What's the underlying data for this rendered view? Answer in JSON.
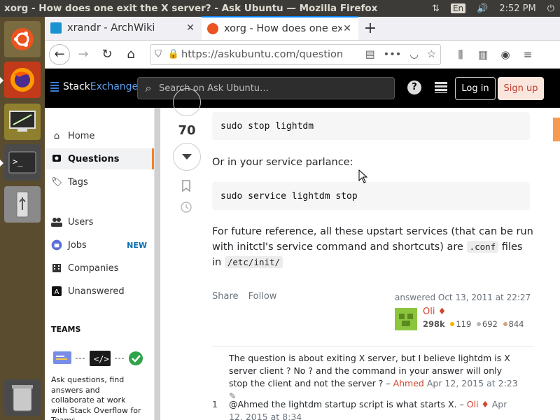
{
  "os_bar": {
    "window_title": "xorg - How does one exit the X server? - Ask Ubuntu — Mozilla Firefox",
    "lang": "En",
    "time": "2:52 PM"
  },
  "launcher": {
    "items": [
      "ubuntu-dash",
      "firefox",
      "screenshot-tool",
      "terminal",
      "usb-drive",
      "trash"
    ]
  },
  "tabs": [
    {
      "label": "xrandr - ArchWiki",
      "active": false
    },
    {
      "label": "xorg - How does one exit the X server? - Ask Ubuntu",
      "active": true
    }
  ],
  "navbar": {
    "url": "https://askubuntu.com/question"
  },
  "se_header": {
    "logo_stack": "Stack",
    "logo_exchange": "Exchange",
    "search_placeholder": "Search on Ask Ubuntu…",
    "help": "?",
    "login": "Log in",
    "signup": "Sign up"
  },
  "leftnav": {
    "items": [
      {
        "label": "Home"
      },
      {
        "label": "Questions"
      },
      {
        "label": "Tags"
      },
      {
        "label": "Users"
      },
      {
        "label": "Jobs",
        "badge": "NEW"
      },
      {
        "label": "Companies"
      },
      {
        "label": "Unanswered"
      }
    ],
    "teams_heading": "TEAMS",
    "teams_text": "Ask questions, find answers and collaborate at work with Stack Overflow for Teams."
  },
  "answer": {
    "vote_count": "70",
    "code1": "sudo stop lightdm",
    "text1": "Or in your service parlance:",
    "code2": "sudo service lightdm stop",
    "text2_a": "For future reference, all these upstart services (that can be run with initctl's service command and shortcuts) are ",
    "text2_code1": ".conf",
    "text2_b": " files in ",
    "text2_code2": "/etc/init/",
    "share": "Share",
    "follow": "Follow",
    "answered": "answered Oct 13, 2011 at 22:27",
    "user_name": "Oli ♦",
    "user_rep": "298k",
    "gold": "119",
    "silver": "692",
    "bronze": "844"
  },
  "comments": [
    {
      "num": "",
      "text": "The question is about exiting X server, but I believe lightdm is X server client ? No ? and the command in your answer will only stop the client and not the server ? – ",
      "user": "Ahmed",
      "date": "Apr 12, 2015 at 2:23"
    },
    {
      "num": "1",
      "text": "@Ahmed the lightdm startup script is what starts X. – ",
      "user": "Oli ♦",
      "date": "Apr 12, 2015 at 8:34"
    }
  ]
}
